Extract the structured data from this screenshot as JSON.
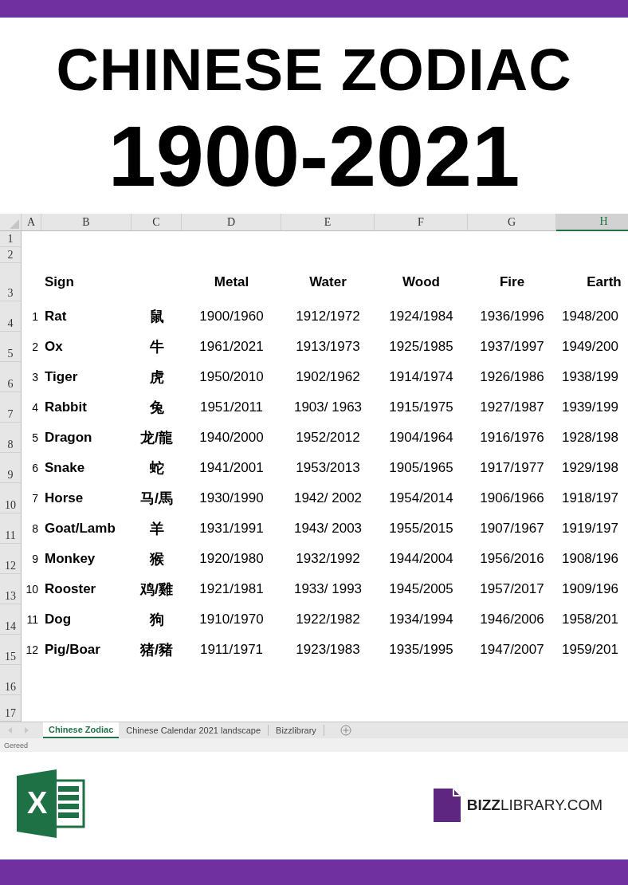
{
  "title": {
    "line_1": "CHINESE ZODIAC",
    "line_2": "1900-2021"
  },
  "sheet": {
    "columns": [
      {
        "letter": "A",
        "selected": false
      },
      {
        "letter": "B",
        "selected": false
      },
      {
        "letter": "C",
        "selected": false
      },
      {
        "letter": "D",
        "selected": false
      },
      {
        "letter": "E",
        "selected": false
      },
      {
        "letter": "F",
        "selected": false
      },
      {
        "letter": "G",
        "selected": false
      },
      {
        "letter": "H",
        "selected": true
      }
    ],
    "row_headers": [
      "1",
      "2",
      "3",
      "4",
      "5",
      "6",
      "7",
      "8",
      "9",
      "10",
      "11",
      "12",
      "13",
      "14",
      "15",
      "16",
      "17"
    ],
    "sign_header": "Sign",
    "element_headers": [
      "Metal",
      "Water",
      "Wood",
      "Fire",
      "Earth"
    ],
    "rows": [
      {
        "number": "1",
        "sign": "Rat",
        "chinese": "鼠",
        "years": [
          "1900/1960",
          "1912/1972",
          "1924/1984",
          "1936/1996",
          "1948/200"
        ]
      },
      {
        "number": "2",
        "sign": "Ox",
        "chinese": "牛",
        "years": [
          "1961/2021",
          "1913/1973",
          "1925/1985",
          "1937/1997",
          "1949/200"
        ]
      },
      {
        "number": "3",
        "sign": "Tiger",
        "chinese": "虎",
        "years": [
          "1950/2010",
          "1902/1962",
          "1914/1974",
          "1926/1986",
          "1938/199"
        ]
      },
      {
        "number": "4",
        "sign": "Rabbit",
        "chinese": "兔",
        "years": [
          "1951/2011",
          "1903/ 1963",
          "1915/1975",
          "1927/1987",
          "1939/199"
        ]
      },
      {
        "number": "5",
        "sign": "Dragon",
        "chinese": "龙/龍",
        "years": [
          "1940/2000",
          "1952/2012",
          "1904/1964",
          "1916/1976",
          "1928/198"
        ]
      },
      {
        "number": "6",
        "sign": "Snake",
        "chinese": "蛇",
        "years": [
          "1941/2001",
          "1953/2013",
          "1905/1965",
          "1917/1977",
          "1929/198"
        ]
      },
      {
        "number": "7",
        "sign": "Horse",
        "chinese": "马/馬",
        "years": [
          "1930/1990",
          "1942/ 2002",
          "1954/2014",
          "1906/1966",
          "1918/197"
        ]
      },
      {
        "number": "8",
        "sign": "Goat/Lamb",
        "chinese": "羊",
        "years": [
          "1931/1991",
          "1943/ 2003",
          "1955/2015",
          "1907/1967",
          "1919/197"
        ]
      },
      {
        "number": "9",
        "sign": "Monkey",
        "chinese": "猴",
        "years": [
          "1920/1980",
          "1932/1992",
          "1944/2004",
          "1956/2016",
          "1908/196"
        ]
      },
      {
        "number": "10",
        "sign": "Rooster",
        "chinese": "鸡/雞",
        "years": [
          "1921/1981",
          "1933/ 1993",
          "1945/2005",
          "1957/2017",
          "1909/196"
        ]
      },
      {
        "number": "11",
        "sign": "Dog",
        "chinese": "狗",
        "years": [
          "1910/1970",
          "1922/1982",
          "1934/1994",
          "1946/2006",
          "1958/201"
        ]
      },
      {
        "number": "12",
        "sign": "Pig/Boar",
        "chinese": "猪/豬",
        "years": [
          "1911/1971",
          "1923/1983",
          "1935/1995",
          "1947/2007",
          "1959/201"
        ]
      }
    ],
    "tabs": [
      {
        "label": "Chinese Zodiac",
        "selected": true
      },
      {
        "label": "Chinese Calendar 2021 landscape",
        "selected": false
      },
      {
        "label": "Bizzlibrary",
        "selected": false
      }
    ],
    "status": "Gereed"
  },
  "footer": {
    "excel_logo_letter": "X",
    "brand": "**BIZZ**LIBRARY.COM"
  }
}
